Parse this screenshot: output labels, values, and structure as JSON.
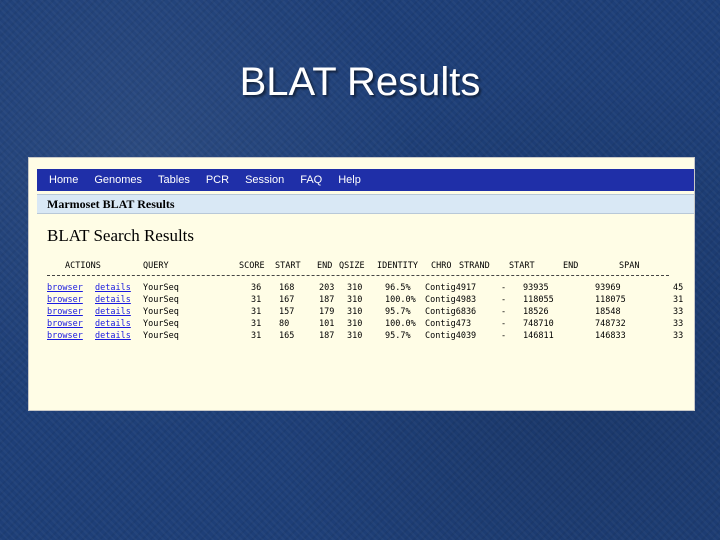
{
  "slide": {
    "title": "BLAT Results"
  },
  "nav": {
    "items": [
      "Home",
      "Genomes",
      "Tables",
      "PCR",
      "Session",
      "FAQ",
      "Help"
    ]
  },
  "subheader": "Marmoset BLAT Results",
  "results_title": "BLAT Search Results",
  "table": {
    "headers": [
      "ACTIONS",
      "QUERY",
      "SCORE",
      "START",
      "END",
      "QSIZE",
      "IDENTITY",
      "CHRO",
      "STRAND",
      "START",
      "END",
      "SPAN"
    ],
    "rows": [
      [
        "browser",
        "details",
        "YourSeq",
        "36",
        "168",
        "203",
        "310",
        "96.5%",
        "Contig4917",
        "-",
        "93935",
        "93969",
        "45"
      ],
      [
        "browser",
        "details",
        "YourSeq",
        "31",
        "167",
        "187",
        "310",
        "100.0%",
        "Contig4983",
        "-",
        "118055",
        "118075",
        "31"
      ],
      [
        "browser",
        "details",
        "YourSeq",
        "31",
        "157",
        "179",
        "310",
        "95.7%",
        "Contig6836",
        "-",
        "18526",
        "18548",
        "33"
      ],
      [
        "browser",
        "details",
        "YourSeq",
        "31",
        "80",
        "101",
        "310",
        "100.0%",
        "Contig473",
        "-",
        "748710",
        "748732",
        "33"
      ],
      [
        "browser",
        "details",
        "YourSeq",
        "31",
        "165",
        "187",
        "310",
        "95.7%",
        "Contig4039",
        "-",
        "146811",
        "146833",
        "33"
      ]
    ]
  }
}
